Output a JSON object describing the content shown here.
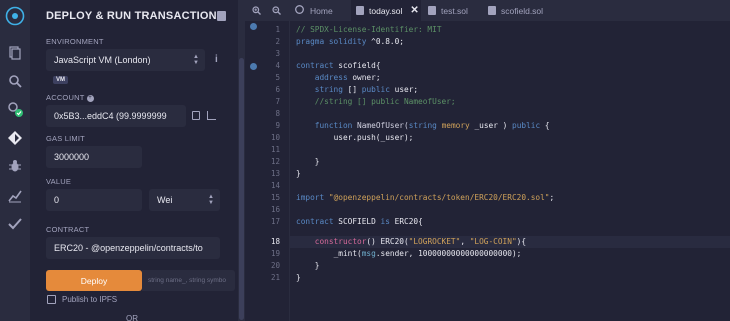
{
  "panel": {
    "title": "DEPLOY & RUN TRANSACTIONS",
    "environment": {
      "label": "ENVIRONMENT",
      "value": "JavaScript VM (London)",
      "badge": "VM"
    },
    "account": {
      "label": "ACCOUNT",
      "value": "0x5B3...eddC4 (99.9999999"
    },
    "gas_limit": {
      "label": "GAS LIMIT",
      "value": "3000000"
    },
    "value": {
      "label": "VALUE",
      "amount": "0",
      "unit": "Wei"
    },
    "contract": {
      "label": "CONTRACT",
      "value": "ERC20 - @openzeppelin/contracts/to"
    },
    "deploy": {
      "button": "Deploy",
      "params_placeholder": "string name_, string symbo"
    },
    "publish": {
      "label": "Publish to IPFS"
    },
    "or": "OR"
  },
  "tabs": {
    "home": "Home",
    "items": [
      "today.sol",
      "test.sol",
      "scofield.sol"
    ]
  },
  "editor": {
    "line_numbers": [
      "1",
      "2",
      "3",
      "4",
      "5",
      "6",
      "7",
      "8",
      "9",
      "10",
      "11",
      "12",
      "13",
      "14",
      "15",
      "16",
      "17",
      "18",
      "19",
      "20",
      "21"
    ],
    "current_line": "18"
  },
  "colors": {
    "accent": "#e58a3b",
    "background": "#222336",
    "panel": "#2a2c3f"
  },
  "icons": [
    "remix-logo-icon",
    "file-explorer-icon",
    "search-icon",
    "plugin-check-icon",
    "deploy-icon",
    "debug-icon",
    "analysis-icon",
    "verify-icon",
    "zoom-in-icon",
    "zoom-out-icon",
    "home-icon",
    "file-icon",
    "close-icon",
    "info-icon",
    "copy-icon",
    "edit-icon",
    "plus-circle-icon"
  ]
}
